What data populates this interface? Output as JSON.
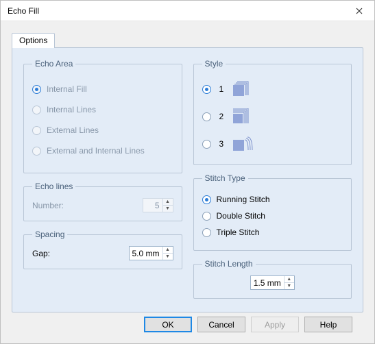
{
  "window": {
    "title": "Echo Fill"
  },
  "tab": {
    "label": "Options"
  },
  "echoArea": {
    "legend": "Echo Area",
    "options": [
      {
        "label": "Internal Fill",
        "selected": true
      },
      {
        "label": "Internal Lines",
        "selected": false
      },
      {
        "label": "External Lines",
        "selected": false
      },
      {
        "label": "External and Internal Lines",
        "selected": false
      }
    ],
    "enabled": false
  },
  "echoLines": {
    "legend": "Echo lines",
    "numberLabel": "Number:",
    "numberValue": "5",
    "enabled": false
  },
  "spacing": {
    "legend": "Spacing",
    "gapLabel": "Gap:",
    "gapValue": "5.0 mm"
  },
  "style": {
    "legend": "Style",
    "options": [
      {
        "label": "1",
        "selected": true
      },
      {
        "label": "2",
        "selected": false
      },
      {
        "label": "3",
        "selected": false
      }
    ]
  },
  "stitchType": {
    "legend": "Stitch Type",
    "options": [
      {
        "label": "Running Stitch",
        "selected": true
      },
      {
        "label": "Double Stitch",
        "selected": false
      },
      {
        "label": "Triple Stitch",
        "selected": false
      }
    ]
  },
  "stitchLength": {
    "legend": "Stitch Length",
    "value": "1.5 mm"
  },
  "buttons": {
    "ok": "OK",
    "cancel": "Cancel",
    "apply": "Apply",
    "help": "Help"
  }
}
